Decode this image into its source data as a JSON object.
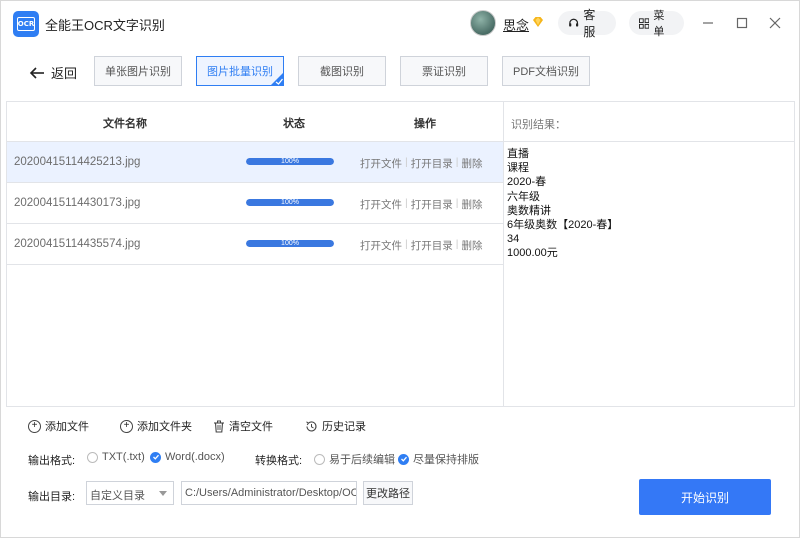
{
  "app": {
    "title": "全能王OCR文字识别",
    "logo_text": "OCR",
    "accent": "#2f7ef3"
  },
  "header": {
    "username": "思念",
    "service_label": "客服",
    "menu_label": "菜单"
  },
  "nav": {
    "back_label": "返回",
    "tabs": [
      {
        "label": "单张图片识别",
        "active": false
      },
      {
        "label": "图片批量识别",
        "active": true
      },
      {
        "label": "截图识别",
        "active": false
      },
      {
        "label": "票证识别",
        "active": false
      },
      {
        "label": "PDF文档识别",
        "active": false
      }
    ]
  },
  "table": {
    "columns": [
      "文件名称",
      "状态",
      "操作"
    ],
    "rows": [
      {
        "filename": "20200415114425213.jpg",
        "progress": 100,
        "progress_text": "100%",
        "open_file": "打开文件",
        "open_dir": "打开目录",
        "delete": "删除",
        "selected": true
      },
      {
        "filename": "20200415114430173.jpg",
        "progress": 100,
        "progress_text": "100%",
        "open_file": "打开文件",
        "open_dir": "打开目录",
        "delete": "删除",
        "selected": false
      },
      {
        "filename": "20200415114435574.jpg",
        "progress": 100,
        "progress_text": "100%",
        "open_file": "打开文件",
        "open_dir": "打开目录",
        "delete": "删除",
        "selected": false
      }
    ]
  },
  "result": {
    "header": "识别结果：",
    "lines": [
      "直播",
      "课程",
      "2020-春",
      "六年级",
      "奥数精讲",
      "6年级奥数【2020-春】",
      "34",
      "1000.00元"
    ]
  },
  "actions": {
    "add_file": "添加文件",
    "add_folder": "添加文件夹",
    "clear_files": "清空文件",
    "history": "历史记录"
  },
  "options": {
    "output_format_label": "输出格式:",
    "format_txt": "TXT(.txt)",
    "format_word": "Word(.docx)",
    "format_selected": "Word(.docx)",
    "convert_format_label": "转换格式:",
    "convert_easy_edit": "易于后续编辑",
    "convert_keep_layout": "尽量保持排版",
    "convert_selected": "尽量保持排版",
    "output_dir_label": "输出目录:",
    "dir_mode": "自定义目录",
    "dir_path": "C:/Users/Administrator/Desktop/OC",
    "change_path_label": "更改路径",
    "start_label": "开始识别"
  }
}
